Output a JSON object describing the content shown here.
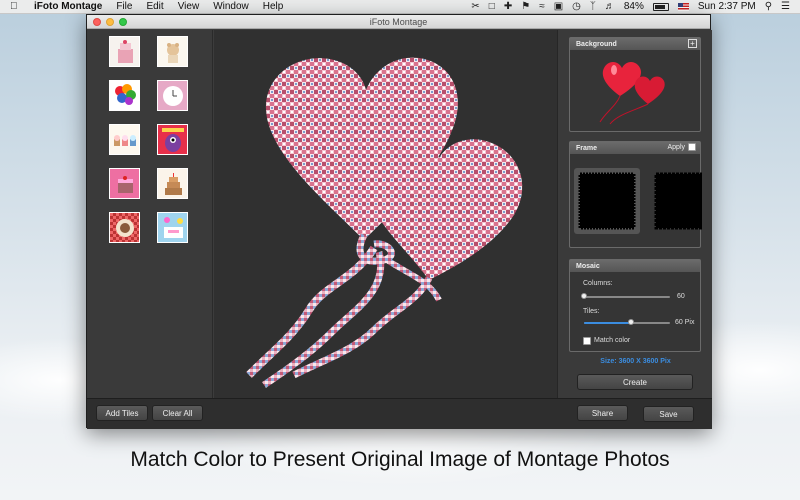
{
  "menubar": {
    "app_name": "iFoto Montage",
    "menus": [
      "File",
      "Edit",
      "View",
      "Window",
      "Help"
    ],
    "battery": "84%",
    "clock": "Sun 2:37 PM"
  },
  "window": {
    "title": "iFoto Montage"
  },
  "thumbnails": [
    {
      "name": "pink-cake"
    },
    {
      "name": "teddy-bear"
    },
    {
      "name": "balloons"
    },
    {
      "name": "clock-card"
    },
    {
      "name": "cupcakes"
    },
    {
      "name": "monster-birthday"
    },
    {
      "name": "pink-cake-2"
    },
    {
      "name": "tiered-cake"
    },
    {
      "name": "checked-cake"
    },
    {
      "name": "blue-party"
    }
  ],
  "background_panel": {
    "title": "Background"
  },
  "frame_panel": {
    "title": "Frame",
    "apply_label": "Apply",
    "apply_checked": false
  },
  "mosaic_panel": {
    "title": "Mosaic",
    "columns_label": "Columns:",
    "columns_value": "60",
    "columns_slider": 0.0,
    "tiles_label": "Tiles:",
    "tiles_value": "60 Pix",
    "tiles_slider": 0.55,
    "match_color_label": "Match color",
    "match_color_checked": false
  },
  "size_text": "Size: 3600 X 3600 Pix",
  "buttons": {
    "create": "Create",
    "add_tiles": "Add Tiles",
    "clear_all": "Clear All",
    "share": "Share",
    "save": "Save"
  },
  "caption": "Match Color to Present Original Image of Montage Photos",
  "colors": {
    "accent": "#3b8de0",
    "window_bg": "#3c3c3c",
    "canvas_bg": "#303030"
  }
}
